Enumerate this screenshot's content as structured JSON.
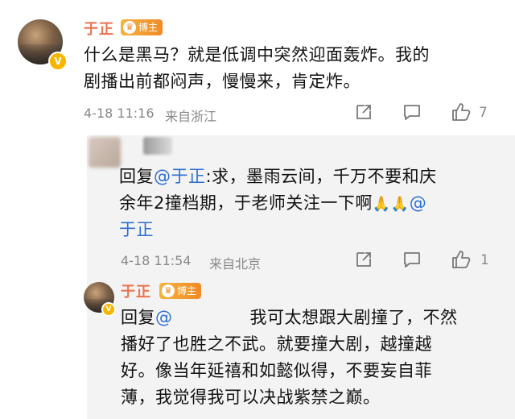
{
  "comment1": {
    "username": "于正",
    "badge": "博主",
    "text_line1": "什么是黑马？就是低调中突然迎面轰炸。我的",
    "text_line2": "剧播出前都闷声，慢慢来，肯定炸。",
    "time": "4-18 11:16",
    "location": "来自浙江",
    "like_count": "7"
  },
  "reply1": {
    "prefix": "回复",
    "mention": "@于正",
    "text_line1_rest": ":求，墨雨云间，千万不要和庆",
    "text_line2": "余年2撞档期，于老师关注一下啊",
    "emoji": "🙏🙏",
    "mention2": "@",
    "text_line3": "于正",
    "time": "4-18 11:54",
    "location": "来自北京",
    "like_count": "1"
  },
  "reply2": {
    "username": "于正",
    "badge": "博主",
    "prefix": "回复",
    "mention": "@",
    "text_line1_rest": "我可太想跟大剧撞了，不然",
    "text_line2": "播好了也胜之不武。就要撞大剧，越撞越",
    "text_line3": "好。像当年延禧和如懿似得，不要妄自菲",
    "text_line4": "薄，我觉得我可以决战紫禁之巅。"
  },
  "colors": {
    "username": "#eb7350",
    "mention": "#2d6fd1",
    "meta": "#888888",
    "reply_bg": "#f3f3f3"
  },
  "icons": [
    "share-icon",
    "comment-icon",
    "like-icon",
    "verified-icon",
    "crown-icon"
  ]
}
